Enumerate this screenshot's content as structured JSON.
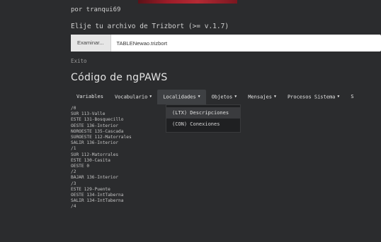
{
  "header": {
    "author": "por tranqui69",
    "prompt": "Elije tu archivo de Trizbort (>= v.1.7)"
  },
  "file_input": {
    "browse_label": "Examinar...",
    "filename": "TABLENewao.trizbort"
  },
  "status": "Exito",
  "title": "Código de ngPAWS",
  "menu": [
    {
      "label": "Variables",
      "caret": false
    },
    {
      "label": "Vocabulario",
      "caret": true
    },
    {
      "label": "Localidades",
      "caret": true
    },
    {
      "label": "Objetos",
      "caret": true
    },
    {
      "label": "Mensajes",
      "caret": true
    },
    {
      "label": "Procesos Sistema",
      "caret": true
    },
    {
      "label": "S",
      "caret": false
    }
  ],
  "dropdown": {
    "items": [
      "(LTX) Descripciones",
      "(CON) Conexiones"
    ]
  },
  "code_lines": [
    "/0",
    "SUR 113-Valle",
    "ESTE 131-Bosquecillo",
    "OESTE 136-Interior",
    "NOROESTE 135-Cascada",
    "SUROESTE 112-Matorrales",
    "SALIR 136-Interior",
    "/1",
    "SUR 112-Matorrales",
    "ESTE 130-Casita",
    "OESTE 0",
    "/2",
    "BAJAR 136-Interior",
    "/3",
    "ESTE 129-Puente",
    "OESTE 134-IntTaberna",
    "SALIR 134-IntTaberna",
    "/4"
  ]
}
